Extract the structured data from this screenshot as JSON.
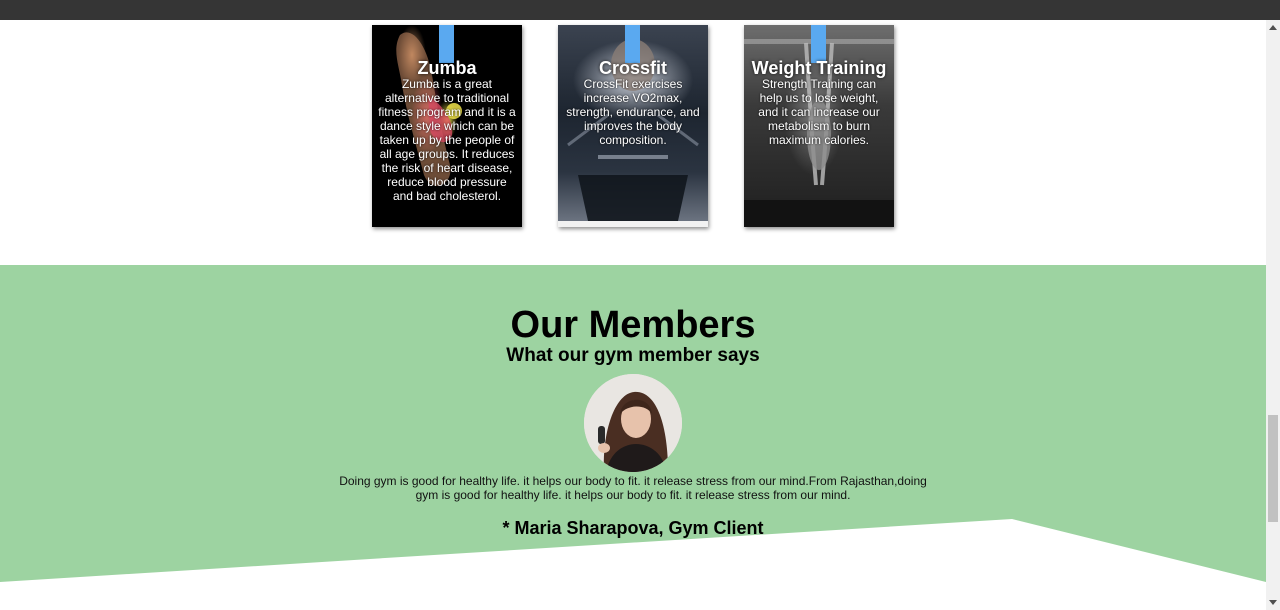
{
  "cards": [
    {
      "title": "Zumba",
      "description": "Zumba is a great alternative to traditional fitness program and it is a dance style which can be taken up by the people of all age groups. It reduces the risk of heart disease, reduce blood pressure and bad cholesterol."
    },
    {
      "title": "Crossfit",
      "description": "CrossFit exercises increase VO2max, strength, endurance, and improves the body composition."
    },
    {
      "title": "Weight Training",
      "description": "Strength Training can help us to lose weight, and it can increase our metabolism to burn maximum calories."
    }
  ],
  "members": {
    "heading": "Our Members",
    "subheading": "What our gym member says",
    "testimonial": "Doing gym is good for healthy life. it helps our body to fit. it release stress from our mind.From Rajasthan,doing gym is good for healthy life. it helps our body to fit. it release stress from our mind.",
    "client": "* Maria Sharapova, Gym Client"
  },
  "colors": {
    "section_background": "#9dd3a1",
    "card_accent": "#5aa9f0",
    "top_bar": "#353535"
  }
}
